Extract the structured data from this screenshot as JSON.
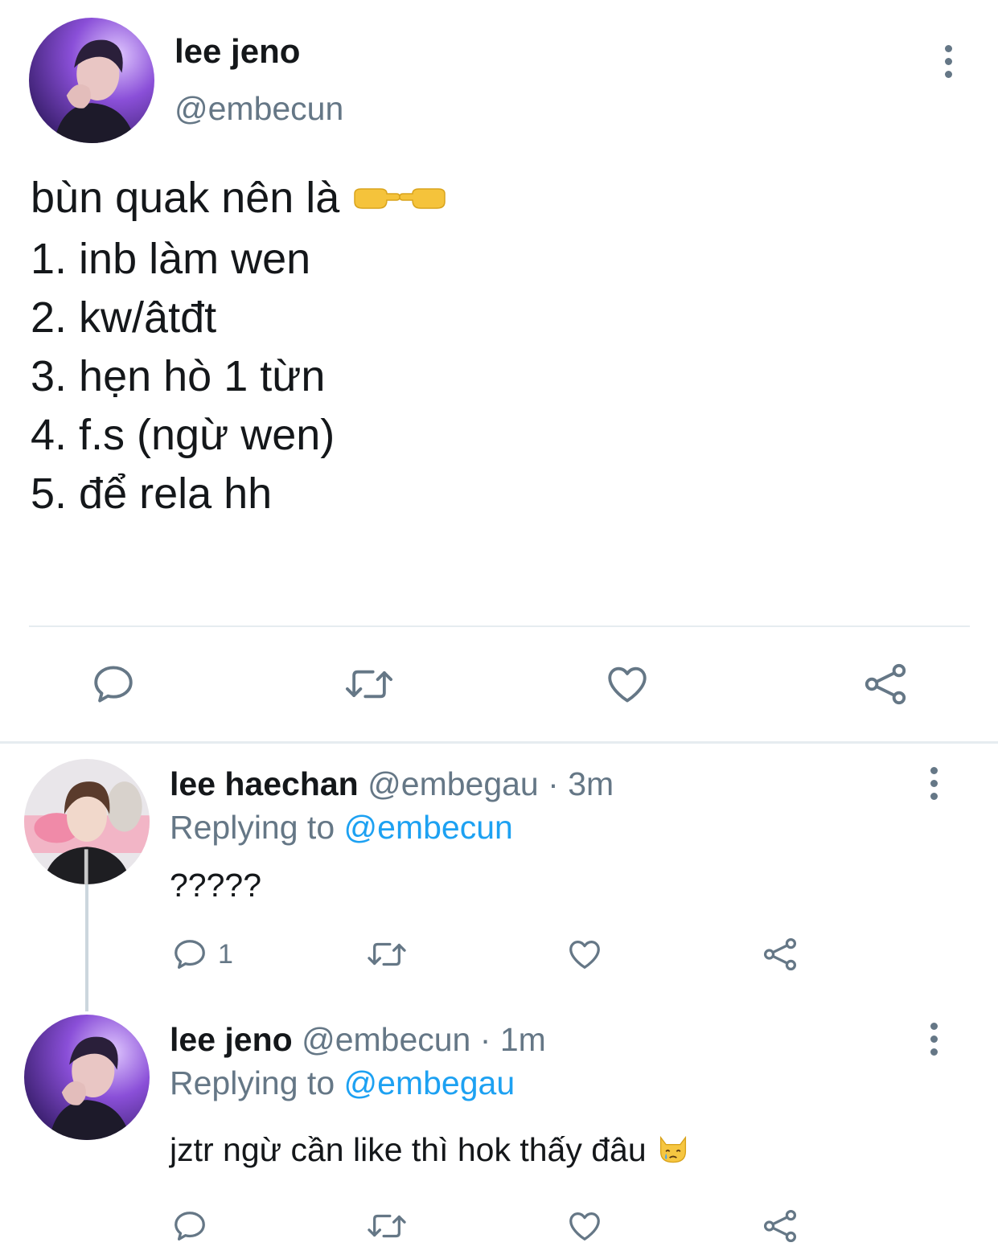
{
  "main_tweet": {
    "author_name": "lee jeno",
    "author_handle": "@embecun",
    "lines": [
      "bùn quak nên là",
      "1. inb làm wen",
      "2. kw/âtđt",
      "3. hẹn hò 1 từn",
      "4. f.s (ngừ wen)",
      "5. để rela hh"
    ],
    "line1_emoji": [
      "backhand-index-right-icon",
      "backhand-index-left-icon"
    ]
  },
  "replies": [
    {
      "author_name": "lee haechan",
      "author_handle": "@embegau",
      "separator": "·",
      "time": "3m",
      "replying_label": "Replying to",
      "replying_to": "@embecun",
      "text": "?????",
      "reply_count": "1"
    },
    {
      "author_name": "lee jeno",
      "author_handle": "@embecun",
      "separator": "·",
      "time": "1m",
      "replying_label": "Replying to",
      "replying_to": "@embegau",
      "text": "jztr ngừ cần like thì hok thấy đâu",
      "text_emoji": "crying-cat-face-icon",
      "reply_count": ""
    }
  ],
  "colors": {
    "text": "#14171a",
    "secondary": "#657786",
    "link": "#1da1f2",
    "divider": "#e6ecf0"
  }
}
